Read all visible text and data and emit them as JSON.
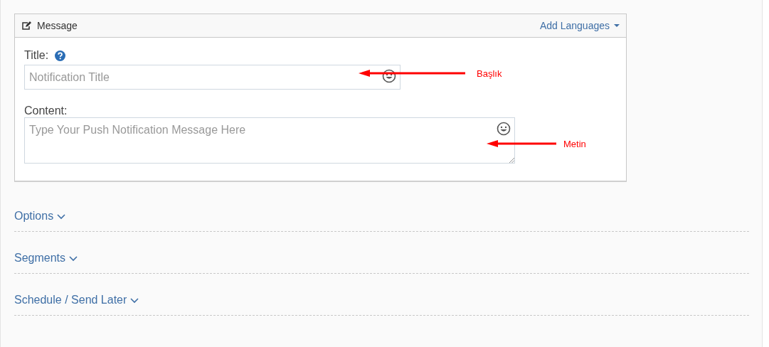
{
  "message_panel": {
    "title": "Message",
    "add_languages": "Add Languages",
    "title_field": {
      "label": "Title:",
      "placeholder": "Notification Title"
    },
    "content_field": {
      "label": "Content:",
      "placeholder": "Type Your Push Notification Message Here"
    }
  },
  "annotations": [
    {
      "label": "Başlık"
    },
    {
      "label": "Metin"
    }
  ],
  "sections": [
    {
      "label": "Options",
      "expanded": false
    },
    {
      "label": "Segments",
      "expanded": false
    },
    {
      "label": "Schedule / Send Later",
      "expanded": false
    }
  ]
}
